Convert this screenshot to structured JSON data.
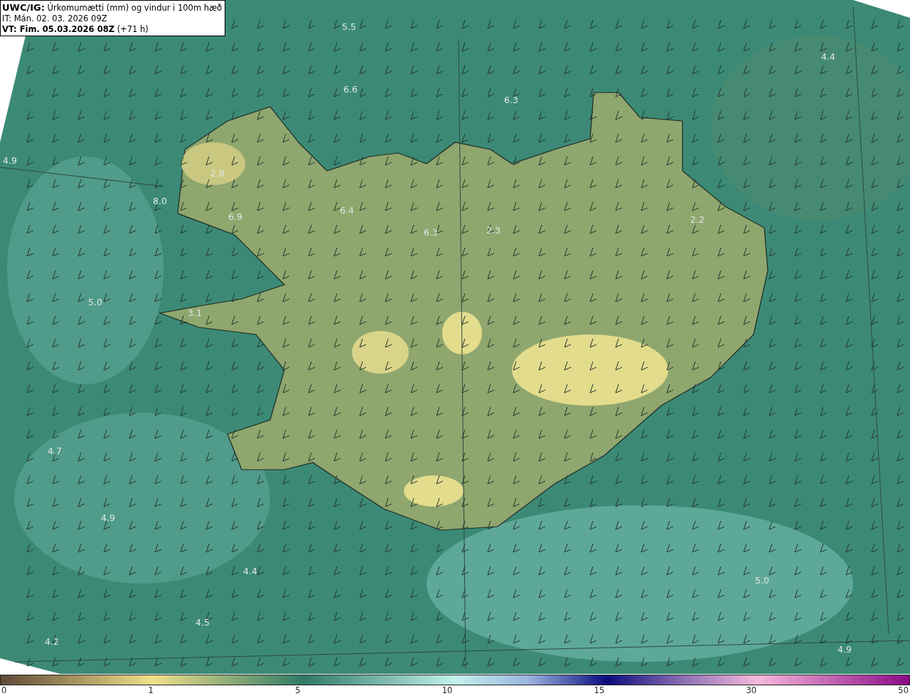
{
  "header": {
    "source": "UWC/IG:",
    "description": "Úrkomumætti (mm) og vindur i 100m hæð",
    "issue_time": "IT: Mán. 02. 03. 2026 09Z",
    "valid_time": "VT: Fim. 05.03.2026 08Z",
    "lead_time": "(+71 h)"
  },
  "map_values": [
    "5.5",
    "4.4",
    "6.6",
    "6.3",
    "4.9",
    "2.8",
    "8.0",
    "6.9",
    "6.4",
    "6.3",
    "2.3",
    "2.2",
    "5.0",
    "3.1",
    "4.7",
    "4.9",
    "4.4",
    "4.5",
    "4.2",
    "5.0",
    "4.9"
  ],
  "colorbar": {
    "ticks": [
      "0",
      "1",
      "5",
      "10",
      "15",
      "30",
      "50"
    ]
  }
}
